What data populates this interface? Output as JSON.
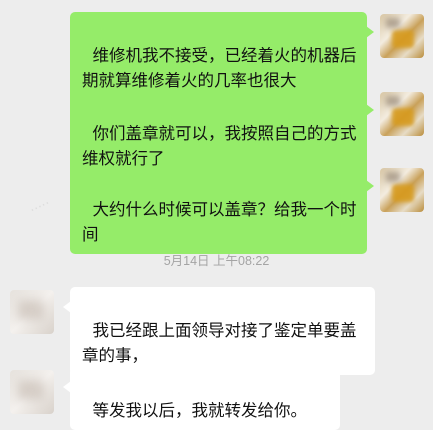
{
  "chat": {
    "messages": [
      {
        "sender": "me",
        "text": "维修机我不接受，已经着火的机器后期就算维修着火的几率也很大"
      },
      {
        "sender": "me",
        "text": "你们盖章就可以，我按照自己的方式维权就行了"
      },
      {
        "sender": "me",
        "text": "大约什么时候可以盖章？给我一个时间"
      },
      {
        "sender": "other",
        "text": "我已经跟上面领导对接了鉴定单要盖章的事，"
      },
      {
        "sender": "other",
        "text": "等发我以后，我就转发给你。"
      }
    ],
    "timestamp": "5月14日 上午08:22"
  }
}
